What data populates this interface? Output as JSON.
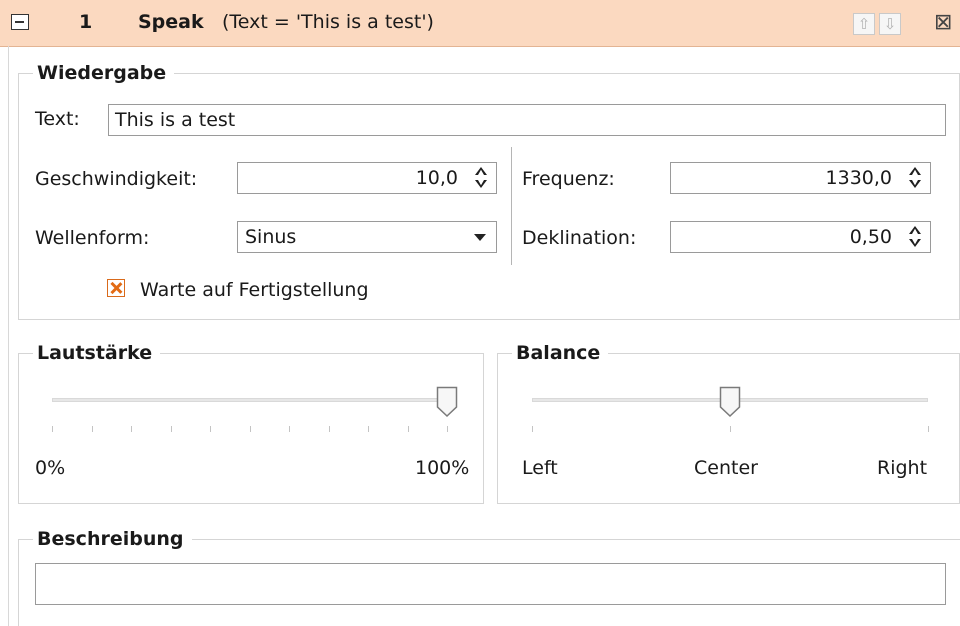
{
  "header": {
    "index": "1",
    "command": "Speak",
    "detail": "(Text = 'This is a test')",
    "move_up_icon": "arrow-up-icon",
    "move_down_icon": "arrow-down-icon",
    "close_icon": "close-icon",
    "background": "#fbd9c0"
  },
  "playback": {
    "title": "Wiedergabe",
    "text_label": "Text:",
    "text_value": "This is a test",
    "speed_label": "Geschwindigkeit:",
    "speed_value": "10,0",
    "waveform_label": "Wellenform:",
    "waveform_value": "Sinus",
    "frequency_label": "Frequenz:",
    "frequency_value": "1330,0",
    "declination_label": "Deklination:",
    "declination_value": "0,50",
    "wait_label": "Warte auf Fertigstellung",
    "wait_checked": true,
    "check_color": "#e26b15"
  },
  "volume": {
    "title": "Lautstärke",
    "min_label": "0%",
    "max_label": "100%",
    "level_fraction": 1.0
  },
  "balance": {
    "title": "Balance",
    "left_label": "Left",
    "center_label": "Center",
    "right_label": "Right",
    "position_fraction": 0.5
  },
  "description": {
    "title": "Beschreibung",
    "value": ""
  }
}
